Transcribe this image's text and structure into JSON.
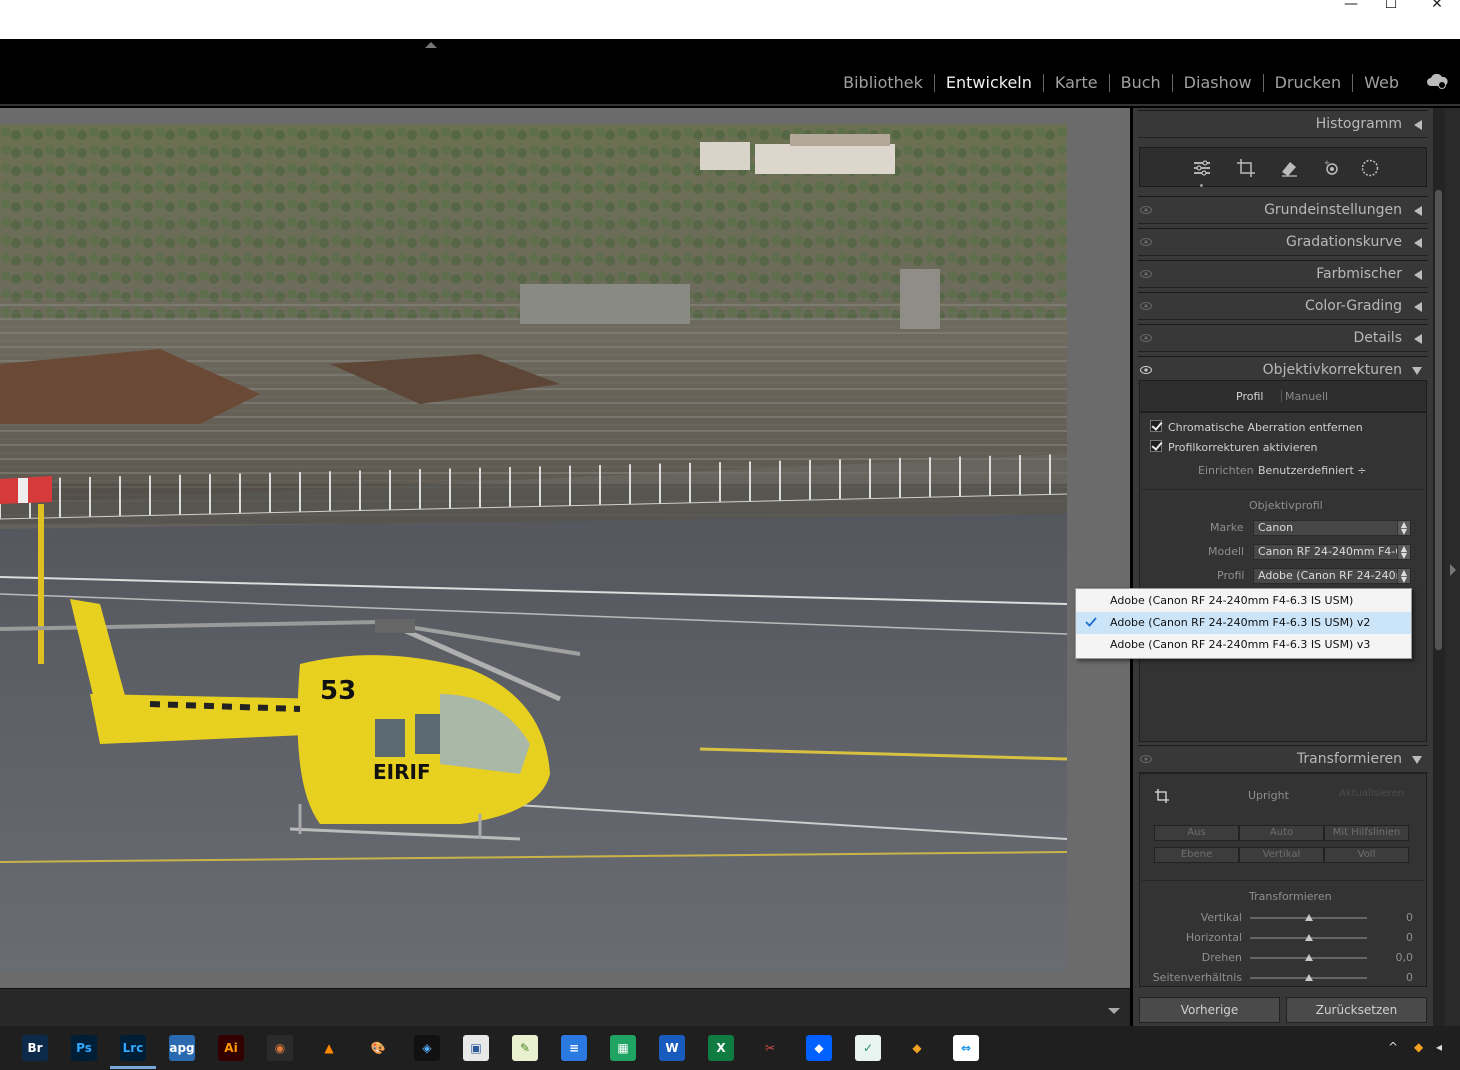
{
  "window": {
    "minimize_glyph": "—",
    "maximize_glyph": "☐",
    "close_glyph": "✕"
  },
  "modules": [
    "Bibliothek",
    "Entwickeln",
    "Karte",
    "Buch",
    "Diashow",
    "Drucken",
    "Web"
  ],
  "active_module": "Entwickeln",
  "panels": {
    "histogram": "Histogramm",
    "basic": "Grundeinstellungen",
    "tone_curve": "Gradationskurve",
    "color_mixer": "Farbmischer",
    "color_grading": "Color-Grading",
    "details": "Details",
    "lens_corrections": "Objektivkorrekturen",
    "transform": "Transformieren"
  },
  "tools": [
    "edit-sliders-icon",
    "crop-icon",
    "healing-icon",
    "red-eye-icon",
    "masking-icon"
  ],
  "lens": {
    "tab_profile": "Profil",
    "tab_manual": "Manuell",
    "remove_ca": "Chromatische Aberration entfernen",
    "enable_profile": "Profilkorrekturen aktivieren",
    "setup_label": "Einrichten",
    "setup_value": "Benutzerdefiniert ÷",
    "profile_heading": "Objektivprofil",
    "make_label": "Marke",
    "make_value": "Canon",
    "model_label": "Modell",
    "model_value": "Canon RF 24-240mm F4-6...",
    "profile_label": "Profil",
    "profile_value": "Adobe (Canon RF 24-240m..."
  },
  "profile_dropdown": {
    "options": [
      "Adobe (Canon RF 24-240mm F4-6.3 IS USM)",
      "Adobe (Canon RF 24-240mm F4-6.3 IS USM) v2",
      "Adobe (Canon RF 24-240mm F4-6.3 IS USM) v3"
    ],
    "selected_index": 1
  },
  "transform": {
    "upright_label": "Upright",
    "update_label": "Aktualisieren",
    "row1": [
      "Aus",
      "Auto",
      "Mit Hilfslinien"
    ],
    "row2": [
      "Ebene",
      "Vertikal",
      "Voll"
    ],
    "heading": "Transformieren",
    "sliders": [
      {
        "label": "Vertikal",
        "value": "0"
      },
      {
        "label": "Horizontal",
        "value": "0"
      },
      {
        "label": "Drehen",
        "value": "0,0"
      },
      {
        "label": "Seitenverhältnis",
        "value": "0"
      }
    ]
  },
  "footer": {
    "previous": "Vorherige",
    "reset": "Zurücksetzen"
  },
  "taskbar": {
    "apps": [
      {
        "name": "bridge-app",
        "label": "Br",
        "bg": "#0c2a4a",
        "fg": "#ffffff"
      },
      {
        "name": "photoshop-app",
        "label": "Ps",
        "bg": "#001e36",
        "fg": "#31a8ff"
      },
      {
        "name": "lightroom-classic-app",
        "label": "Lrc",
        "bg": "#001e36",
        "fg": "#31a8ff"
      },
      {
        "name": "apg-app",
        "label": "apg",
        "bg": "#2a6ab0",
        "fg": "#ffffff"
      },
      {
        "name": "illustrator-app",
        "label": "Ai",
        "bg": "#330000",
        "fg": "#ff9a00"
      },
      {
        "name": "resolve-app",
        "label": "◉",
        "bg": "#2b2b2b",
        "fg": "#e07a3a"
      },
      {
        "name": "vlc-app",
        "label": "▲",
        "bg": "#1f1f1f",
        "fg": "#ff8800"
      },
      {
        "name": "paint-app",
        "label": "🎨",
        "bg": "#1f1f1f",
        "fg": "#ffffff"
      },
      {
        "name": "dxo-app",
        "label": "◈",
        "bg": "#111111",
        "fg": "#5bb0ff"
      },
      {
        "name": "viewer-app",
        "label": "▣",
        "bg": "#e8e8e8",
        "fg": "#2a5a9a"
      },
      {
        "name": "notes-app",
        "label": "✎",
        "bg": "#e8f0d0",
        "fg": "#4a8a20"
      },
      {
        "name": "docs-app",
        "label": "≡",
        "bg": "#2a7ae2",
        "fg": "#ffffff"
      },
      {
        "name": "sheets-app",
        "label": "▦",
        "bg": "#1fa463",
        "fg": "#ffffff"
      },
      {
        "name": "word-app",
        "label": "W",
        "bg": "#185abd",
        "fg": "#ffffff"
      },
      {
        "name": "excel-app",
        "label": "X",
        "bg": "#107c41",
        "fg": "#ffffff"
      },
      {
        "name": "snip-app",
        "label": "✂",
        "bg": "#1f1f1f",
        "fg": "#d04a4a"
      },
      {
        "name": "dropbox-app",
        "label": "◆",
        "bg": "#0061fe",
        "fg": "#ffffff"
      },
      {
        "name": "maps-app",
        "label": "✓",
        "bg": "#e8f4f0",
        "fg": "#2a8a6a"
      },
      {
        "name": "sketch-app",
        "label": "◆",
        "bg": "#1f1f1f",
        "fg": "#f0a020"
      },
      {
        "name": "teamviewer-app",
        "label": "⇔",
        "bg": "#ffffff",
        "fg": "#0e8ee9"
      }
    ],
    "tray_chevron": "^"
  }
}
